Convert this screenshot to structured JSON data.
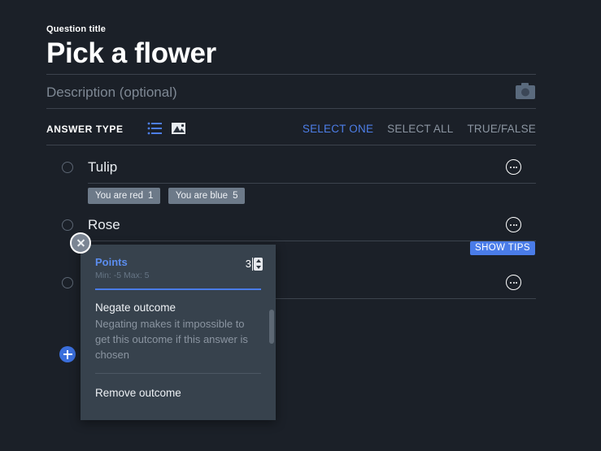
{
  "header": {
    "eyebrow": "Question title",
    "title": "Pick a flower",
    "description_placeholder": "Description (optional)",
    "camera_icon": "camera-icon"
  },
  "answer_type": {
    "label": "ANSWER TYPE",
    "icons": [
      {
        "name": "list-icon",
        "active": true
      },
      {
        "name": "image-icon",
        "active": false
      }
    ],
    "modes": [
      {
        "label": "SELECT ONE",
        "active": true
      },
      {
        "label": "SELECT ALL",
        "active": false
      },
      {
        "label": "TRUE/FALSE",
        "active": false
      }
    ]
  },
  "answers": [
    {
      "text": "Tulip",
      "menu_icon": "ellipsis-icon",
      "outcomes": [
        {
          "label": "You are red",
          "points": "1"
        },
        {
          "label": "You are blue",
          "points": "5"
        }
      ]
    },
    {
      "text": "Rose",
      "menu_icon": "ellipsis-icon",
      "outcomes": []
    },
    {
      "text": "",
      "menu_icon": "ellipsis-icon",
      "outcomes": []
    }
  ],
  "add_answer": {
    "icon": "plus-icon"
  },
  "show_tips": {
    "label": "SHOW TIPS"
  },
  "close_button": {
    "icon": "close-icon"
  },
  "popup": {
    "points": {
      "title": "Points",
      "subtitle": "Min: -5 Max: 5",
      "value": "3",
      "spinner_icon": "spinner-icon"
    },
    "negate": {
      "title": "Negate outcome",
      "description": "Negating makes it impossible to get this outcome if this answer is chosen"
    },
    "remove": {
      "title": "Remove outcome"
    }
  },
  "colors": {
    "background": "#1b2028",
    "popup_background": "#37424d",
    "accent_blue": "#4a7ce8",
    "points_blue": "#5b8def",
    "chip_background": "#6d7a89",
    "muted_text": "#8b95a1",
    "divider": "#3c434d"
  }
}
